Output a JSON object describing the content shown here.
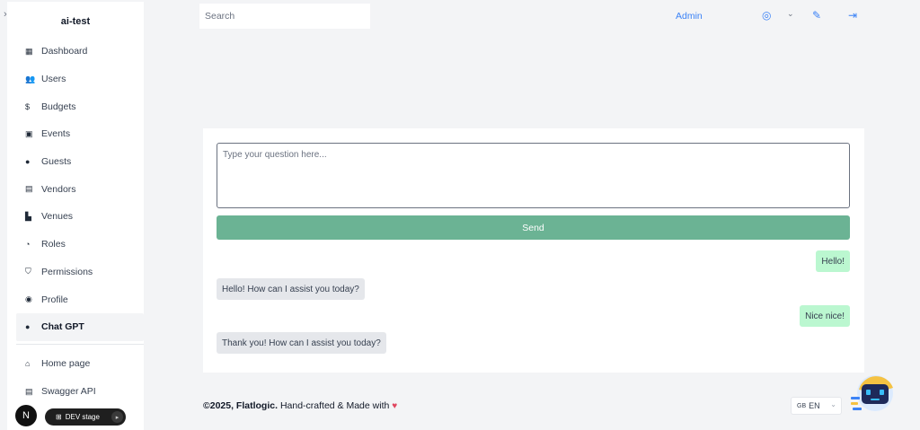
{
  "app": {
    "brand": "ai-test",
    "collapse_glyph": "›"
  },
  "sidebar": {
    "items": [
      {
        "label": "Dashboard",
        "icon": "dashboard-icon",
        "glyph": "▦",
        "active": false
      },
      {
        "label": "Users",
        "icon": "users-icon",
        "glyph": "👥",
        "active": false
      },
      {
        "label": "Budgets",
        "icon": "dollar-icon",
        "glyph": "$",
        "active": false
      },
      {
        "label": "Events",
        "icon": "calendar-icon",
        "glyph": "▣",
        "active": false
      },
      {
        "label": "Guests",
        "icon": "person-icon",
        "glyph": "●",
        "active": false
      },
      {
        "label": "Vendors",
        "icon": "store-icon",
        "glyph": "▤",
        "active": false
      },
      {
        "label": "Venues",
        "icon": "building-icon",
        "glyph": "▙",
        "active": false
      },
      {
        "label": "Roles",
        "icon": "roles-icon",
        "glyph": "◔",
        "active": false
      },
      {
        "label": "Permissions",
        "icon": "shield-icon",
        "glyph": "⛉",
        "active": false
      },
      {
        "label": "Profile",
        "icon": "profile-icon",
        "glyph": "◉",
        "active": false
      },
      {
        "label": "Chat GPT",
        "icon": "chat-icon",
        "glyph": "●",
        "active": true
      }
    ],
    "secondary": [
      {
        "label": "Home page",
        "icon": "home-icon",
        "glyph": "⌂"
      },
      {
        "label": "Swagger API",
        "icon": "document-icon",
        "glyph": "▤"
      }
    ],
    "avatar_letter": "N",
    "dev_badge": {
      "label": "DEV stage",
      "glyph": "⊞",
      "knob": "▸"
    }
  },
  "topbar": {
    "search_placeholder": "Search",
    "user_label": "Admin",
    "icons": {
      "profile": "◎",
      "chevron": "⌄",
      "theme": "✎",
      "logout": "⇥"
    }
  },
  "chat": {
    "placeholder": "Type your question here...",
    "send_label": "Send",
    "messages": [
      {
        "role": "user",
        "text": "Hello!"
      },
      {
        "role": "bot",
        "text": "Hello! How can I assist you today?"
      },
      {
        "role": "user",
        "text": "Nice nice!"
      },
      {
        "role": "bot",
        "text": "Thank you! How can I assist you today?"
      }
    ]
  },
  "footer": {
    "copyright": "©2025, Flatlogic.",
    "tagline": "Hand-crafted & Made with",
    "heart": "♥"
  },
  "language": {
    "value": "EN",
    "flag": "GB",
    "chevron": "⌄"
  },
  "colors": {
    "accent": "#3b82f6",
    "send": "#6bb394",
    "user_bubble": "#bbf7d0",
    "bot_bubble": "#e5e7eb",
    "heart": "#e0455f"
  }
}
